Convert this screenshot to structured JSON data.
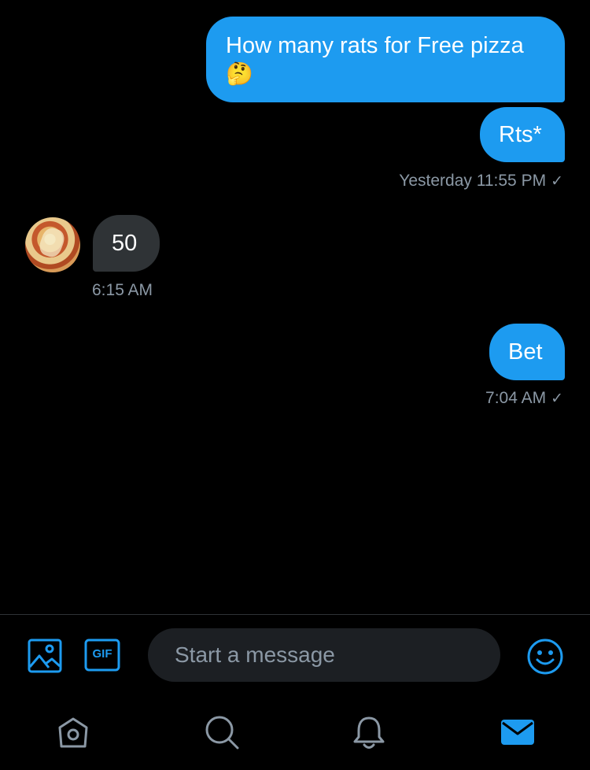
{
  "messages": {
    "m1": {
      "text": "How many rats for Free pizza",
      "emoji": "🤔"
    },
    "m2": {
      "text": "Rts*"
    },
    "ts1": {
      "text": "Yesterday 11:55 PM",
      "check": "✓"
    },
    "m3": {
      "text": "50"
    },
    "ts2": {
      "text": "6:15 AM"
    },
    "m4": {
      "text": "Bet"
    },
    "ts3": {
      "text": "7:04 AM",
      "check": "✓"
    }
  },
  "composer": {
    "placeholder": "Start a message",
    "gif_label": "GIF"
  },
  "icons": {
    "image": "image-icon",
    "gif": "gif-icon",
    "emoji": "smiley-icon",
    "home": "home-icon",
    "search": "search-icon",
    "notifications": "bell-icon",
    "messages": "mail-icon"
  },
  "colors": {
    "accent": "#1d9bf0",
    "background": "#000000",
    "incoming_bubble": "#2f3336",
    "muted_text": "#8b98a5",
    "inactive_icon": "#8b98a5"
  }
}
